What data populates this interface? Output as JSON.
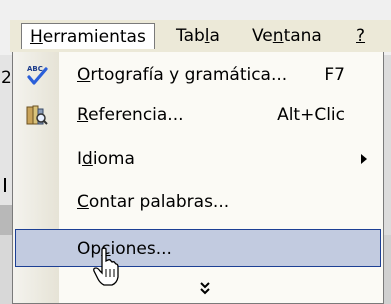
{
  "menubar": {
    "items": [
      {
        "label": "Herramientas",
        "mnemonic_index": 0,
        "open": true
      },
      {
        "label": "Tabla",
        "mnemonic_index": 3,
        "open": false
      },
      {
        "label": "Ventana",
        "mnemonic_index": 2,
        "open": false
      },
      {
        "label": "?",
        "mnemonic_index": 0,
        "open": false
      }
    ]
  },
  "background": {
    "left_digit": "2"
  },
  "menu": {
    "items": [
      {
        "label": "Ortografía y gramática...",
        "shortcut": "F7",
        "icon": "spelling-check-icon"
      },
      {
        "label": "Referencia...",
        "shortcut": "Alt+Clic",
        "icon": "research-books-icon"
      },
      {
        "label": "Idioma",
        "shortcut": "",
        "icon": "",
        "has_submenu": true
      },
      {
        "label": "Contar palabras...",
        "shortcut": "",
        "icon": ""
      },
      {
        "label": "Opciones...",
        "shortcut": "",
        "icon": "",
        "highlighted": true
      }
    ],
    "expand_icon": "chevron-double-down-icon"
  },
  "colors": {
    "menubar_bg": "#ece9d8",
    "highlight_bg": "#c2cbe0",
    "highlight_border": "#1c3f94"
  }
}
